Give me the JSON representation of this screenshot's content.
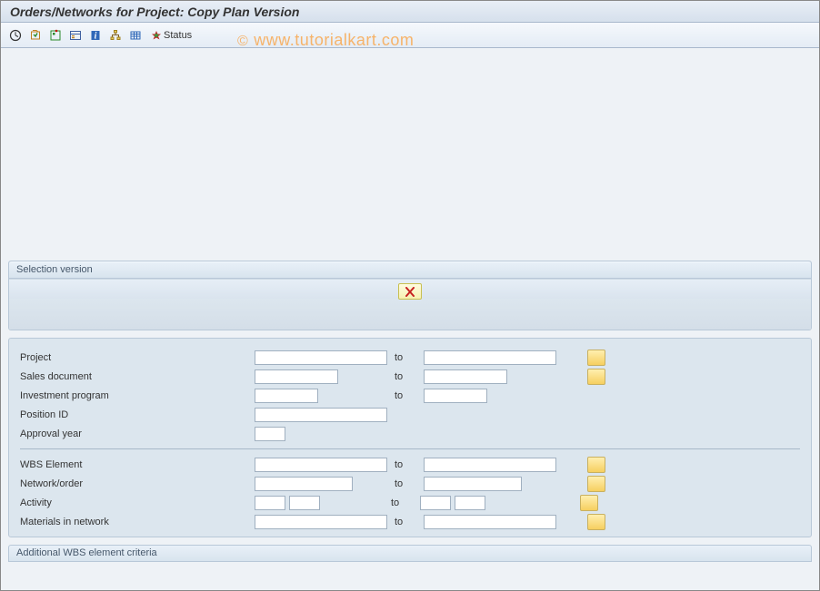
{
  "title": "Orders/Networks for Project: Copy Plan Version",
  "watermark": "© www.tutorialkart.com",
  "toolbar": {
    "status_label": "Status"
  },
  "groups": {
    "selection_version": "Selection version",
    "additional_wbs": "Additional WBS element criteria"
  },
  "labels": {
    "project": "Project",
    "sales_document": "Sales document",
    "investment_program": "Investment program",
    "position_id": "Position ID",
    "approval_year": "Approval year",
    "wbs_element": "WBS Element",
    "network_order": "Network/order",
    "activity": "Activity",
    "materials_in_network": "Materials in network",
    "to": "to"
  },
  "fields": {
    "project_from": "",
    "project_to": "",
    "sales_from": "",
    "sales_to": "",
    "inv_prog_from": "",
    "inv_prog_to": "",
    "position_id": "",
    "approval_year": "",
    "wbs_from": "",
    "wbs_to": "",
    "network_from": "",
    "network_to": "",
    "activity_from_a": "",
    "activity_from_b": "",
    "activity_to_a": "",
    "activity_to_b": "",
    "materials_from": "",
    "materials_to": ""
  }
}
